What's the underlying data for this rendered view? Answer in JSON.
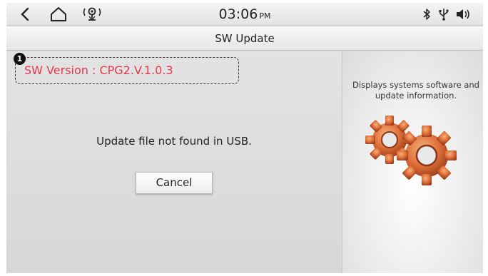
{
  "status_bar": {
    "time": "03:06",
    "ampm": "PM",
    "icons": [
      "back-icon",
      "home-icon",
      "connectivity-icon",
      "bluetooth-icon",
      "usb-icon",
      "volume-icon"
    ]
  },
  "title": "SW Update",
  "version": {
    "callout_number": "1",
    "text": "SW Version : CPG2.V.1.0.3",
    "color": "#e4374a"
  },
  "main": {
    "message": "Update file not found in USB.",
    "cancel_label": "Cancel"
  },
  "info_panel": {
    "description": "Displays systems software and update information.",
    "image_icon": "gears-icon"
  }
}
